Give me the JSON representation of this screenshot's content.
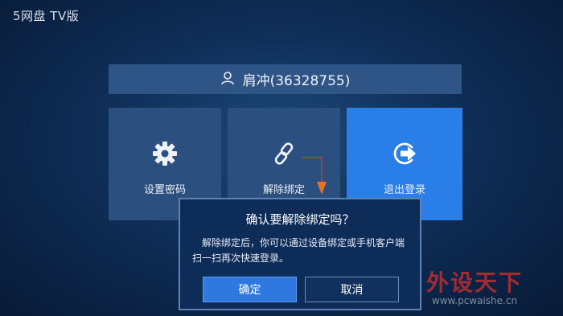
{
  "app": {
    "brand": "5网盘 TV版"
  },
  "account": {
    "user_label": "肩冲(36328755)",
    "icon": "user-icon"
  },
  "tiles": [
    {
      "label": "设置密码",
      "icon": "gear-icon"
    },
    {
      "label": "解除绑定",
      "icon": "link-icon"
    },
    {
      "label": "退出登录",
      "icon": "logout-icon",
      "selected": true
    }
  ],
  "dialog": {
    "title": "确认要解除绑定吗？",
    "message": "解除绑定后，你可以通过设备绑定或手机客户端扫一扫再次快速登录。",
    "confirm_label": "确定",
    "cancel_label": "取消"
  },
  "watermark": {
    "text": "外设天下",
    "url": "www.pcwaishe.cn"
  },
  "colors": {
    "background": "#0f2e58",
    "tile": "#2b4f7f",
    "tile_selected": "#2a7ee8",
    "dialog_bg": "#0e2c58",
    "confirm_button": "#2f78e0",
    "pointer_arrow": "#e8731f"
  }
}
